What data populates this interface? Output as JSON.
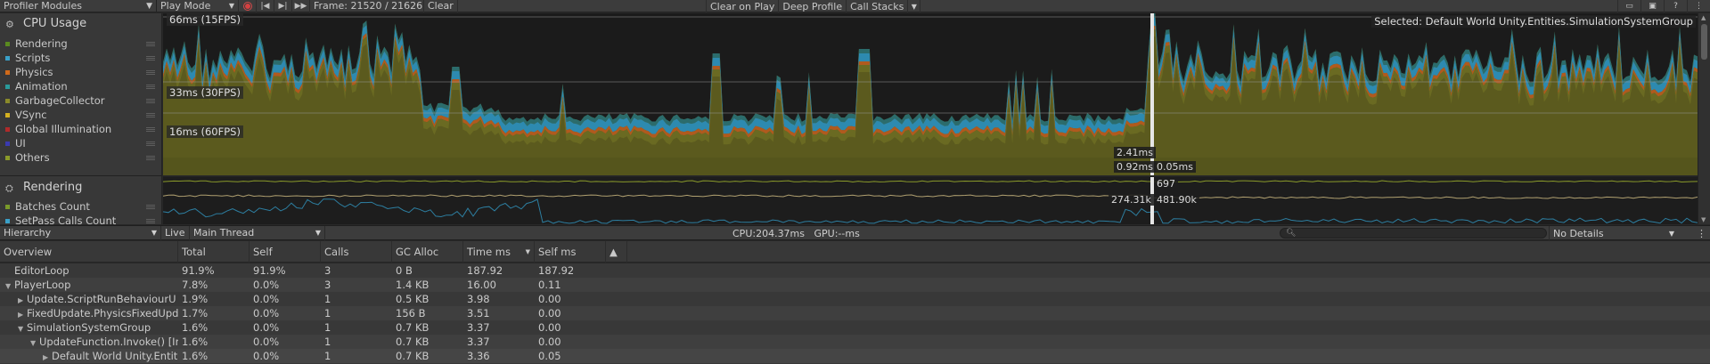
{
  "toolbar": {
    "modules_label": "Profiler Modules",
    "mode_label": "Play Mode",
    "frame_label": "Frame: 21520 / 21626",
    "clear_label": "Clear",
    "clear_on_play_label": "Clear on Play",
    "deep_profile_label": "Deep Profile",
    "call_stacks_label": "Call Stacks"
  },
  "cpu_module": {
    "title": "CPU Usage",
    "legend": [
      {
        "label": "Rendering",
        "color": "#5a8a1f"
      },
      {
        "label": "Scripts",
        "color": "#3aa0c8"
      },
      {
        "label": "Physics",
        "color": "#d06a1a"
      },
      {
        "label": "Animation",
        "color": "#2a9a9a"
      },
      {
        "label": "GarbageCollector",
        "color": "#8a8a2a"
      },
      {
        "label": "VSync",
        "color": "#d4b020"
      },
      {
        "label": "Global Illumination",
        "color": "#b02a2a"
      },
      {
        "label": "UI",
        "color": "#3a3ab0"
      },
      {
        "label": "Others",
        "color": "#8a9a2a"
      }
    ],
    "fps_lines": [
      "66ms (15FPS)",
      "33ms (30FPS)",
      "16ms (60FPS)"
    ],
    "selected_text": "Selected: Default World Unity.Entities.SimulationSystemGroup",
    "marker_values": {
      "top": "2.41ms",
      "left": "0.92ms",
      "right": "0.05ms"
    }
  },
  "rendering_module": {
    "title": "Rendering",
    "legend": [
      {
        "label": "Batches Count",
        "color": "#7a9a2a"
      },
      {
        "label": "SetPass Calls Count",
        "color": "#3aa0c8"
      }
    ],
    "marker_values": {
      "a": "697",
      "b": "274.31k",
      "c": "481.90k"
    }
  },
  "hierarchy_toolbar": {
    "view_label": "Hierarchy",
    "live_label": "Live",
    "thread_label": "Main Thread",
    "cpu_gpu_label": "CPU:204.37ms   GPU:--ms",
    "details_label": "No Details"
  },
  "table": {
    "columns": [
      "Overview",
      "Total",
      "Self",
      "Calls",
      "GC Alloc",
      "Time ms",
      "Self ms",
      "▲"
    ],
    "rows": [
      {
        "name": "EditorLoop",
        "indent": 0,
        "arrow": "",
        "total": "91.9%",
        "self": "91.9%",
        "calls": "3",
        "gc": "0 B",
        "time": "187.92",
        "selfms": "187.92"
      },
      {
        "name": "PlayerLoop",
        "indent": 0,
        "arrow": "▼",
        "total": "7.8%",
        "self": "0.0%",
        "calls": "3",
        "gc": "1.4 KB",
        "time": "16.00",
        "selfms": "0.11"
      },
      {
        "name": "Update.ScriptRunBehaviourU",
        "indent": 1,
        "arrow": "▶",
        "total": "1.9%",
        "self": "0.0%",
        "calls": "1",
        "gc": "0.5 KB",
        "time": "3.98",
        "selfms": "0.00"
      },
      {
        "name": "FixedUpdate.PhysicsFixedUpd",
        "indent": 1,
        "arrow": "▶",
        "total": "1.7%",
        "self": "0.0%",
        "calls": "1",
        "gc": "156 B",
        "time": "3.51",
        "selfms": "0.00"
      },
      {
        "name": "SimulationSystemGroup",
        "indent": 1,
        "arrow": "▼",
        "total": "1.6%",
        "self": "0.0%",
        "calls": "1",
        "gc": "0.7 KB",
        "time": "3.37",
        "selfms": "0.00"
      },
      {
        "name": "UpdateFunction.Invoke() [In",
        "indent": 2,
        "arrow": "▼",
        "total": "1.6%",
        "self": "0.0%",
        "calls": "1",
        "gc": "0.7 KB",
        "time": "3.37",
        "selfms": "0.00"
      },
      {
        "name": "Default World Unity.Entit",
        "indent": 3,
        "arrow": "▶",
        "total": "1.6%",
        "self": "0.0%",
        "calls": "1",
        "gc": "0.7 KB",
        "time": "3.36",
        "selfms": "0.05"
      }
    ]
  }
}
